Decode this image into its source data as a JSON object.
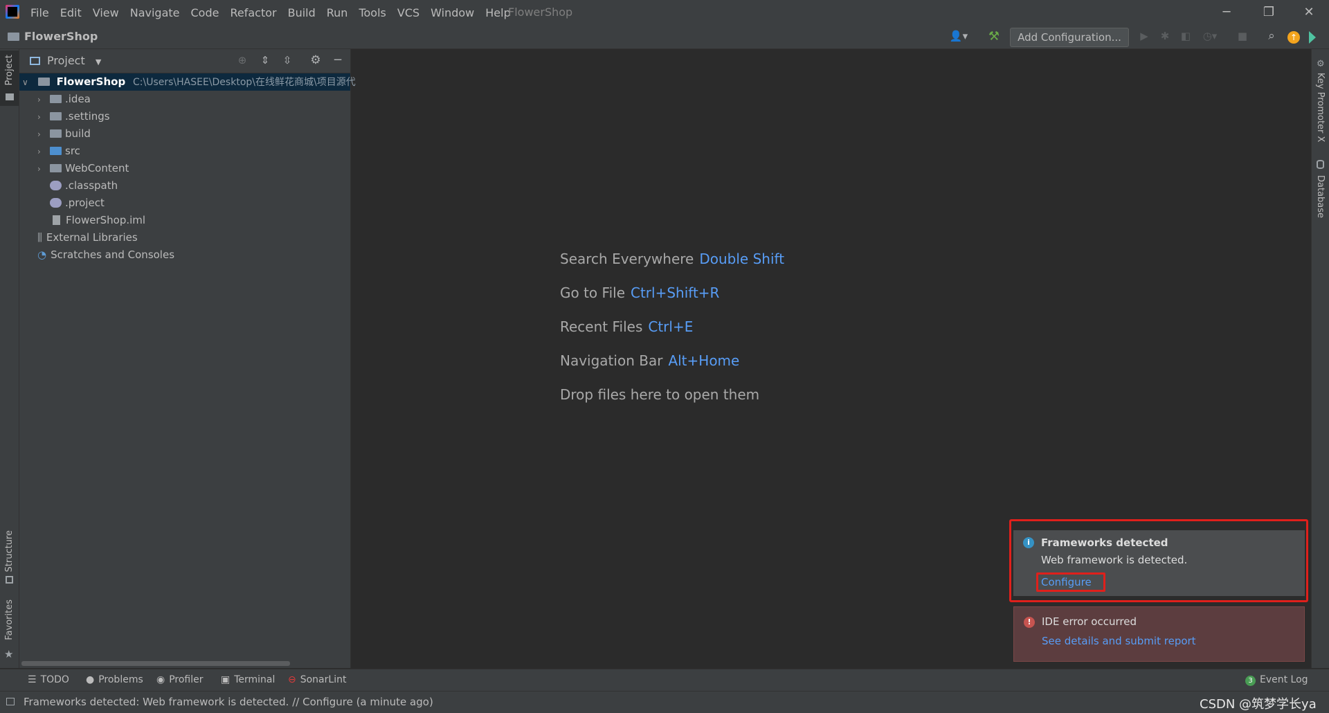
{
  "menu": [
    "File",
    "Edit",
    "View",
    "Navigate",
    "Code",
    "Refactor",
    "Build",
    "Run",
    "Tools",
    "VCS",
    "Window",
    "Help"
  ],
  "app_title": "FlowerShop",
  "window_controls": {
    "minimize": "─",
    "restore": "❐",
    "close": "✕"
  },
  "navbar": {
    "project_name": "FlowerShop",
    "run_config": "Add Configuration..."
  },
  "left_strip": {
    "project": "Project",
    "structure": "Structure",
    "favorites": "Favorites"
  },
  "right_strip": {
    "key_promoter": "Key Promoter X",
    "database": "Database"
  },
  "project_panel": {
    "title": "Project",
    "root": {
      "name": "FlowerShop",
      "path": "C:\\Users\\HASEE\\Desktop\\在线鲜花商城\\项目源代"
    },
    "items": [
      {
        "name": ".idea",
        "kind": "folder"
      },
      {
        "name": ".settings",
        "kind": "folder"
      },
      {
        "name": "build",
        "kind": "folder"
      },
      {
        "name": "src",
        "kind": "folder-source"
      },
      {
        "name": "WebContent",
        "kind": "folder"
      },
      {
        "name": ".classpath",
        "kind": "file"
      },
      {
        "name": ".project",
        "kind": "file"
      },
      {
        "name": "FlowerShop.iml",
        "kind": "file-iml"
      }
    ],
    "external_libraries": "External Libraries",
    "scratches": "Scratches and Consoles"
  },
  "editor_hints": [
    {
      "label": "Search Everywhere",
      "key": "Double Shift"
    },
    {
      "label": "Go to File",
      "key": "Ctrl+Shift+R"
    },
    {
      "label": "Recent Files",
      "key": "Ctrl+E"
    },
    {
      "label": "Navigation Bar",
      "key": "Alt+Home"
    },
    {
      "label": "Drop files here to open them",
      "key": ""
    }
  ],
  "notifications": {
    "frameworks": {
      "title": "Frameworks detected",
      "body": "Web framework is detected.",
      "action": "Configure"
    },
    "ide_error": {
      "title": "IDE error occurred",
      "action": "See details and submit report"
    }
  },
  "bottom_tools": {
    "todo": "TODO",
    "problems": "Problems",
    "profiler": "Profiler",
    "terminal": "Terminal",
    "sonarlint": "SonarLint",
    "event_log": "Event Log",
    "event_count": "3"
  },
  "status": {
    "message": "Frameworks detected: Web framework is detected. // Configure (a minute ago)",
    "watermark": "CSDN @筑梦学长ya"
  },
  "colors": {
    "accent": "#589df6",
    "highlight": "#e0201b",
    "background": "#2b2b2b",
    "panel": "#3c3f41"
  }
}
